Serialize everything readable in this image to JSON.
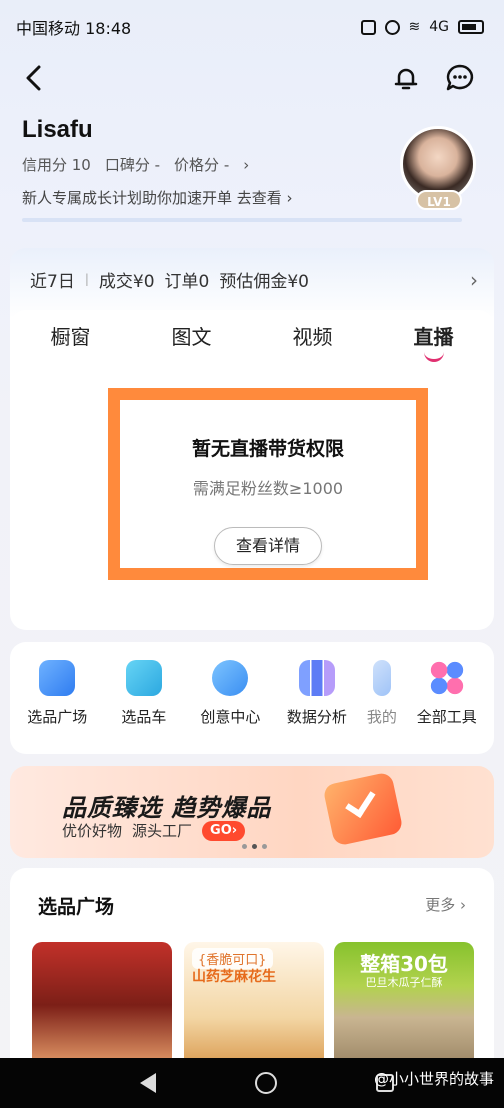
{
  "status": {
    "carrier_time": "中国移动 18:48",
    "network": "4G"
  },
  "profile": {
    "username": "Lisafu",
    "credit": "信用分 10",
    "reputation": "口碑分 -",
    "price": "价格分 -",
    "growth_text": "新人专属成长计划助你加速开单 去查看 ›",
    "level": "LV1"
  },
  "stats": {
    "period": "近7日",
    "deals": "成交¥0",
    "orders": "订单0",
    "commission": "预估佣金¥0"
  },
  "tabs": [
    "橱窗",
    "图文",
    "视频",
    "直播"
  ],
  "empty": {
    "title": "暂无直播带货权限",
    "subtitle": "需满足粉丝数≥1000",
    "button": "查看详情"
  },
  "tools": [
    {
      "label": "选品广场",
      "icon": "shopping-bag-icon",
      "color": "#3b8cf5"
    },
    {
      "label": "选品车",
      "icon": "cart-icon",
      "color": "#33b6e8"
    },
    {
      "label": "创意中心",
      "icon": "bulb-icon",
      "color": "#4aa8f5"
    },
    {
      "label": "数据分析",
      "icon": "chart-icon",
      "color": "#6b7cf6"
    },
    {
      "label": "我的",
      "icon": "user-icon",
      "color": "#9fc3f7"
    },
    {
      "label": "全部工具",
      "icon": "grid-icon",
      "color": "#e85aa3"
    }
  ],
  "banner": {
    "title": "品质臻选 趋势爆品",
    "sub1": "优价好物",
    "sub2": "源头工厂",
    "go": "GO›"
  },
  "select": {
    "title": "选品广场",
    "more": "更多 ›",
    "p2_tag": "{香脆可口}",
    "p2_name": "山药芝麻花生",
    "p3_title": "整箱30包",
    "p3_sub": "巴旦木瓜子仁酥"
  },
  "watermark": "@小小世界的故事"
}
